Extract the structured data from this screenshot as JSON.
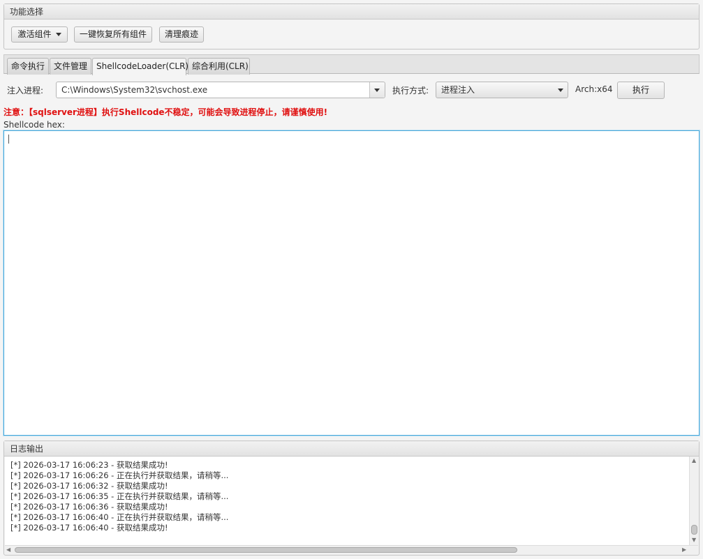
{
  "function_pane": {
    "title": "功能选择",
    "activate_button": "激活组件",
    "restore_button": "一键恢复所有组件",
    "clean_button": "清理痕迹"
  },
  "tabs": [
    {
      "label": "命令执行",
      "active": false
    },
    {
      "label": "文件管理",
      "active": false
    },
    {
      "label": "ShellcodeLoader(CLR)",
      "active": true
    },
    {
      "label": "综合利用(CLR)",
      "active": false
    }
  ],
  "inject": {
    "process_label": "注入进程:",
    "process_value": "C:\\Windows\\System32\\svchost.exe",
    "method_label": "执行方式:",
    "method_value": "进程注入",
    "arch_label": "Arch:x64",
    "execute_button": "执行"
  },
  "warning": "注意：【sqlserver进程】执行Shellcode不稳定，可能会导致进程停止，请谨慎使用!",
  "shellcode_label": "Shellcode hex:",
  "shellcode_value": "",
  "log_pane": {
    "title": "日志输出",
    "lines": [
      "[*] 2026-03-17 16:06:23 - 获取结果成功!",
      "[*] 2026-03-17 16:06:26 - 正在执行并获取结果，请稍等...",
      "[*] 2026-03-17 16:06:32 - 获取结果成功!",
      "[*] 2026-03-17 16:06:35 - 正在执行并获取结果，请稍等...",
      "[*] 2026-03-17 16:06:36 - 获取结果成功!",
      "[*] 2026-03-17 16:06:40 - 正在执行并获取结果，请稍等...",
      "[*] 2026-03-17 16:06:40 - 获取结果成功!"
    ]
  },
  "colors": {
    "warning": "#e01010",
    "focus_border": "#46a7d9"
  }
}
